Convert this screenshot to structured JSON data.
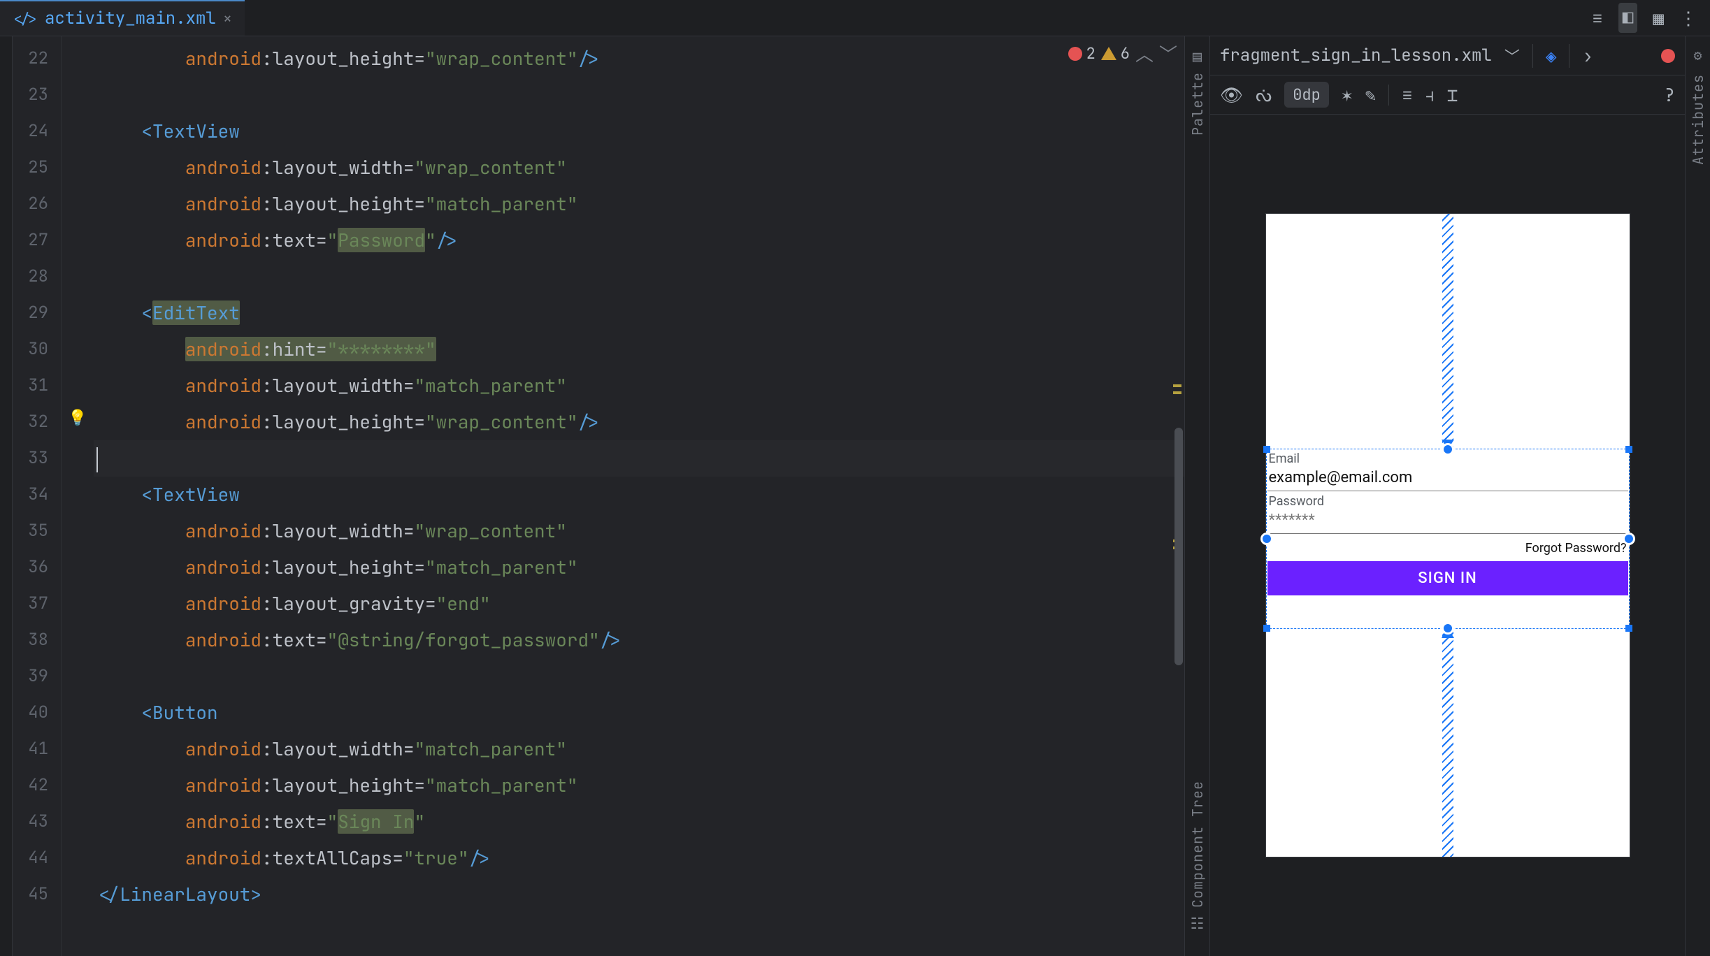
{
  "tab": {
    "filename": "activity_main.xml"
  },
  "top_icons": {
    "list": "list-icon",
    "split": "split-icon",
    "design": "design-icon",
    "more": "more-icon"
  },
  "editor": {
    "first_line": 22,
    "bulb_line": 32,
    "cursor_line": 33,
    "errors": "2",
    "warnings": "6",
    "lines": [
      "        android:layout_height=\"wrap_content\"/>",
      "",
      "    <TextView",
      "        android:layout_width=\"wrap_content\"",
      "        android:layout_height=\"match_parent\"",
      "        android:text=\"Password\"/>",
      "",
      "    <EditText",
      "        android:hint=\"********\"",
      "        android:layout_width=\"match_parent\"",
      "        android:layout_height=\"wrap_content\"/>",
      "",
      "    <TextView",
      "        android:layout_width=\"wrap_content\"",
      "        android:layout_height=\"match_parent\"",
      "        android:layout_gravity=\"end\"",
      "        android:text=\"@string/forgot_password\"/>",
      "",
      "    <Button",
      "        android:layout_width=\"match_parent\"",
      "        android:layout_height=\"match_parent\"",
      "        android:text=\"Sign In\"",
      "        android:textAllCaps=\"true\"/>",
      "</LinearLayout>"
    ],
    "highlight_tags": [
      "EditText"
    ],
    "highlight_attr_line_idx": 8,
    "highlight_literals": [
      "Password",
      "Sign In"
    ]
  },
  "rails": {
    "palette": "Palette",
    "component_tree": "Component Tree",
    "attributes": "Attributes"
  },
  "preview": {
    "filename": "fragment_sign_in_lesson.xml",
    "default_margin": "0dp",
    "email_label": "Email",
    "email_value": "example@email.com",
    "password_label": "Password",
    "password_hint": "*******",
    "forgot": "Forgot Password?",
    "button": "SIGN IN"
  }
}
